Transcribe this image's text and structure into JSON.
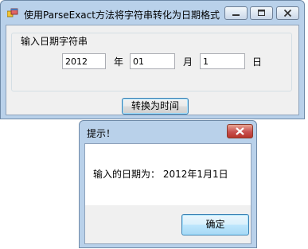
{
  "main_window": {
    "title": "使用ParseExact方法将字符串转化为日期格式",
    "group_label": "输入日期字符串",
    "year_value": "2012",
    "year_label": "年",
    "month_value": "01",
    "month_label": "月",
    "day_value": "1",
    "day_label": "日",
    "convert_button": "转换为时间"
  },
  "dialog": {
    "title": "提示！",
    "message": "输入的日期为： 2012年1月1日",
    "ok_button": "确定"
  },
  "icons": {
    "app": "app-window-icon",
    "minimize": "minimize-icon",
    "maximize": "maximize-icon",
    "close": "close-icon"
  }
}
